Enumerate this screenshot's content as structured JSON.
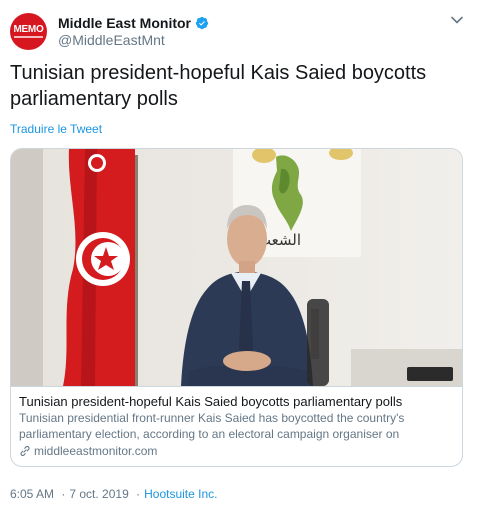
{
  "account": {
    "name": "Middle East Monitor",
    "handle": "@MiddleEastMnt",
    "avatar_text": "MEMO",
    "verified": true
  },
  "tweet": {
    "text": "Tunisian president-hopeful Kais Saied boycotts parliamentary polls",
    "translate_label": "Traduire le Tweet"
  },
  "card": {
    "image_sign_text": "الشعب يريد",
    "title": "Tunisian president-hopeful Kais Saied boycotts parliamentary polls",
    "description": "Tunisian presidential front-runner Kais Saied has boycotted the country's parliamentary election, according to an electoral campaign organiser on Sunday....",
    "domain": "middleeastmonitor.com"
  },
  "meta": {
    "time": "6:05 AM",
    "date": "7 oct. 2019",
    "separator": "·",
    "source": "Hootsuite Inc."
  },
  "colors": {
    "accent": "#1b95e0",
    "muted": "#657786",
    "text": "#14171a",
    "memo_red": "#d7171f",
    "flag_red": "#d41c1f"
  }
}
